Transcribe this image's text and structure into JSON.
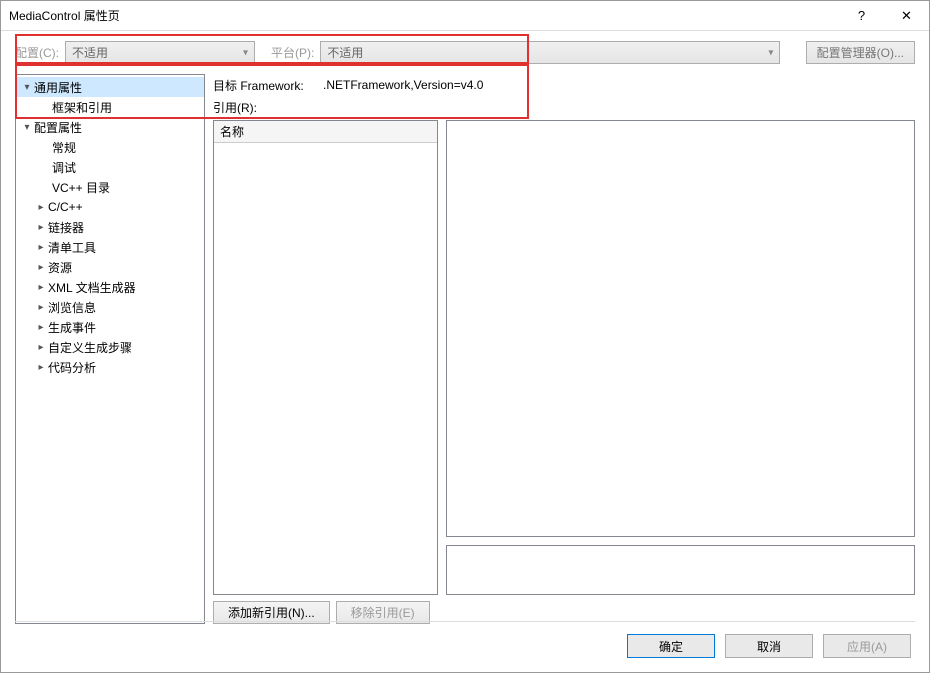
{
  "window": {
    "title": "MediaControl 属性页",
    "help": "?",
    "close": "✕"
  },
  "toolbar": {
    "config_label": "配置(C):",
    "config_value": "不适用",
    "platform_label": "平台(P):",
    "platform_value": "不适用",
    "config_mgr": "配置管理器(O)..."
  },
  "tree": {
    "general": {
      "label": "通用属性",
      "framework": "框架和引用"
    },
    "config": {
      "label": "配置属性",
      "items": [
        "常规",
        "调试",
        "VC++ 目录",
        "C/C++",
        "链接器",
        "清单工具",
        "资源",
        "XML 文档生成器",
        "浏览信息",
        "生成事件",
        "自定义生成步骤",
        "代码分析"
      ]
    }
  },
  "right": {
    "target_framework_label": "目标 Framework:",
    "target_framework_value": ".NETFramework,Version=v4.0",
    "references_label": "引用(R):",
    "name_header": "名称",
    "add_ref": "添加新引用(N)...",
    "remove_ref": "移除引用(E)"
  },
  "dialog": {
    "ok": "确定",
    "cancel": "取消",
    "apply": "应用(A)"
  }
}
